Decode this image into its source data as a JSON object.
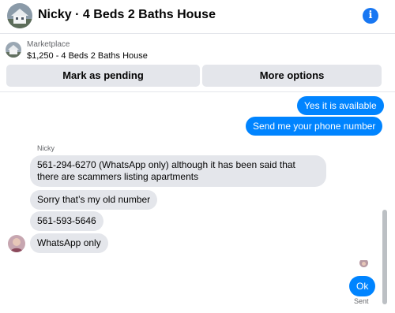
{
  "header": {
    "title": "Nicky · 4 Beds 2 Baths House",
    "avatar_icon": "house-photo-icon",
    "info_icon": "info-icon",
    "info_glyph": "i",
    "accent": "#1877f2"
  },
  "listing": {
    "source": "Marketplace",
    "price_title": "$1,250 - 4 Beds 2 Baths House",
    "thumb_icon": "house-photo-icon",
    "pending_label": "Mark as pending",
    "more_label": "More options"
  },
  "messages": {
    "outgoing": [
      {
        "text": "Yes it is available"
      },
      {
        "text": "Send me your phone number"
      }
    ],
    "sender_name": "Nicky",
    "incoming": [
      {
        "text": "561-294-6270 (WhatsApp only) although it has been said that there are scammers listing apartments"
      },
      {
        "text": "Sorry that’s my old number"
      },
      {
        "text": "561-593-5646"
      },
      {
        "text": "WhatsApp only"
      }
    ],
    "reply": {
      "text": "Ok"
    },
    "status": "Sent",
    "bubble_color": "#0084ff",
    "incoming_color": "#e4e6eb"
  }
}
